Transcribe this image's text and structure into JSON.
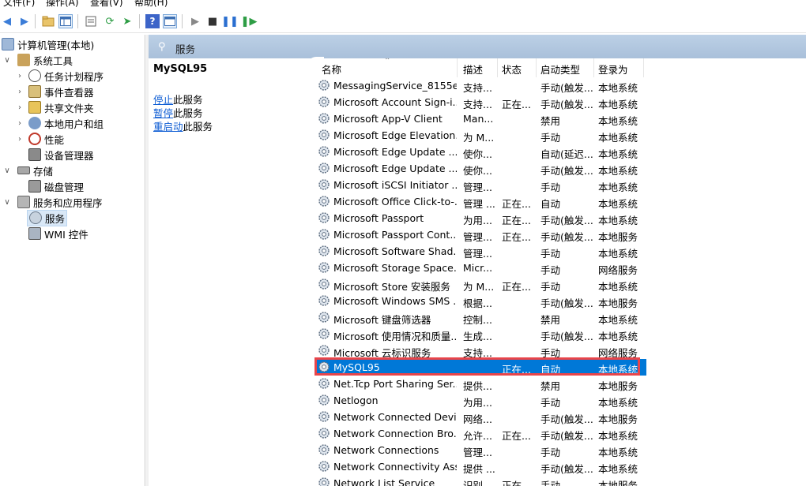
{
  "menu": {
    "items": [
      "文件(F)",
      "操作(A)",
      "查看(V)",
      "帮助(H)"
    ]
  },
  "toolbar": {
    "icons": [
      "back-arrow-icon",
      "forward-arrow-icon",
      "folder-icon",
      "show-hide-console-tree-icon",
      "properties-icon",
      "refresh-icon",
      "export-icon",
      "help-icon",
      "console-icon",
      "play-icon",
      "stop-icon",
      "pause-icon",
      "resume-icon"
    ]
  },
  "tree": {
    "root": "计算机管理(本地)",
    "system_tools": "系统工具",
    "task_scheduler": "任务计划程序",
    "event_viewer": "事件查看器",
    "shared_folders": "共享文件夹",
    "local_users": "本地用户和组",
    "performance": "性能",
    "device_manager": "设备管理器",
    "storage": "存储",
    "disk_management": "磁盘管理",
    "services_apps": "服务和应用程序",
    "services": "服务",
    "wmi": "WMI 控件"
  },
  "header": {
    "title": "服务"
  },
  "description": {
    "service_name": "MySQL95",
    "stop_link": "停止",
    "stop_suffix": "此服务",
    "pause_link": "暂停",
    "pause_suffix": "此服务",
    "restart_link": "重启动",
    "restart_suffix": "此服务"
  },
  "columns": {
    "name": "名称",
    "description": "描述",
    "status": "状态",
    "startup_type": "启动类型",
    "log_on_as": "登录为"
  },
  "services": [
    {
      "name": "MessagingService_8155e",
      "desc": "支持...",
      "status": "",
      "startup": "手动(触发...",
      "logon": "本地系统"
    },
    {
      "name": "Microsoft Account Sign-i...",
      "desc": "支持...",
      "status": "正在...",
      "startup": "手动(触发...",
      "logon": "本地系统"
    },
    {
      "name": "Microsoft App-V Client",
      "desc": "Man...",
      "status": "",
      "startup": "禁用",
      "logon": "本地系统"
    },
    {
      "name": "Microsoft Edge Elevation...",
      "desc": "为 M...",
      "status": "",
      "startup": "手动",
      "logon": "本地系统"
    },
    {
      "name": "Microsoft Edge Update ...",
      "desc": "使你...",
      "status": "",
      "startup": "自动(延迟...",
      "logon": "本地系统"
    },
    {
      "name": "Microsoft Edge Update ...",
      "desc": "使你...",
      "status": "",
      "startup": "手动(触发...",
      "logon": "本地系统"
    },
    {
      "name": "Microsoft iSCSI Initiator ...",
      "desc": "管理...",
      "status": "",
      "startup": "手动",
      "logon": "本地系统"
    },
    {
      "name": "Microsoft Office Click-to-...",
      "desc": "管理 ...",
      "status": "正在...",
      "startup": "自动",
      "logon": "本地系统"
    },
    {
      "name": "Microsoft Passport",
      "desc": "为用...",
      "status": "正在...",
      "startup": "手动(触发...",
      "logon": "本地系统"
    },
    {
      "name": "Microsoft Passport Cont...",
      "desc": "管理...",
      "status": "正在...",
      "startup": "手动(触发...",
      "logon": "本地服务"
    },
    {
      "name": "Microsoft Software Shad...",
      "desc": "管理...",
      "status": "",
      "startup": "手动",
      "logon": "本地系统"
    },
    {
      "name": "Microsoft Storage Space...",
      "desc": "Micr...",
      "status": "",
      "startup": "手动",
      "logon": "网络服务"
    },
    {
      "name": "Microsoft Store 安装服务",
      "desc": "为 M...",
      "status": "正在...",
      "startup": "手动",
      "logon": "本地系统"
    },
    {
      "name": "Microsoft Windows SMS ...",
      "desc": "根据...",
      "status": "",
      "startup": "手动(触发...",
      "logon": "本地服务"
    },
    {
      "name": "Microsoft 键盘筛选器",
      "desc": "控制...",
      "status": "",
      "startup": "禁用",
      "logon": "本地系统"
    },
    {
      "name": "Microsoft 使用情况和质量...",
      "desc": "生成...",
      "status": "",
      "startup": "手动(触发...",
      "logon": "本地系统"
    },
    {
      "name": "Microsoft 云标识服务",
      "desc": "支持...",
      "status": "",
      "startup": "手动",
      "logon": "网络服务"
    },
    {
      "name": "MySQL95",
      "desc": "",
      "status": "正在...",
      "startup": "自动",
      "logon": "本地系统",
      "selected": true
    },
    {
      "name": "Net.Tcp Port Sharing Ser...",
      "desc": "提供...",
      "status": "",
      "startup": "禁用",
      "logon": "本地服务"
    },
    {
      "name": "Netlogon",
      "desc": "为用...",
      "status": "",
      "startup": "手动",
      "logon": "本地系统"
    },
    {
      "name": "Network Connected Devi...",
      "desc": "网络...",
      "status": "",
      "startup": "手动(触发...",
      "logon": "本地服务"
    },
    {
      "name": "Network Connection Bro...",
      "desc": "允许...",
      "status": "正在...",
      "startup": "手动(触发...",
      "logon": "本地系统"
    },
    {
      "name": "Network Connections",
      "desc": "管理...",
      "status": "",
      "startup": "手动",
      "logon": "本地系统"
    },
    {
      "name": "Network Connectivity Ass...",
      "desc": "提供 ...",
      "status": "",
      "startup": "手动(触发...",
      "logon": "本地系统"
    },
    {
      "name": "Network List Service",
      "desc": "识别...",
      "status": "正在...",
      "startup": "手动",
      "logon": "本地服务"
    }
  ],
  "colors": {
    "selection": "#0078d7",
    "highlight_border": "#e8454a",
    "link": "#0b5bd3",
    "header_band": "#b3c8e0"
  }
}
